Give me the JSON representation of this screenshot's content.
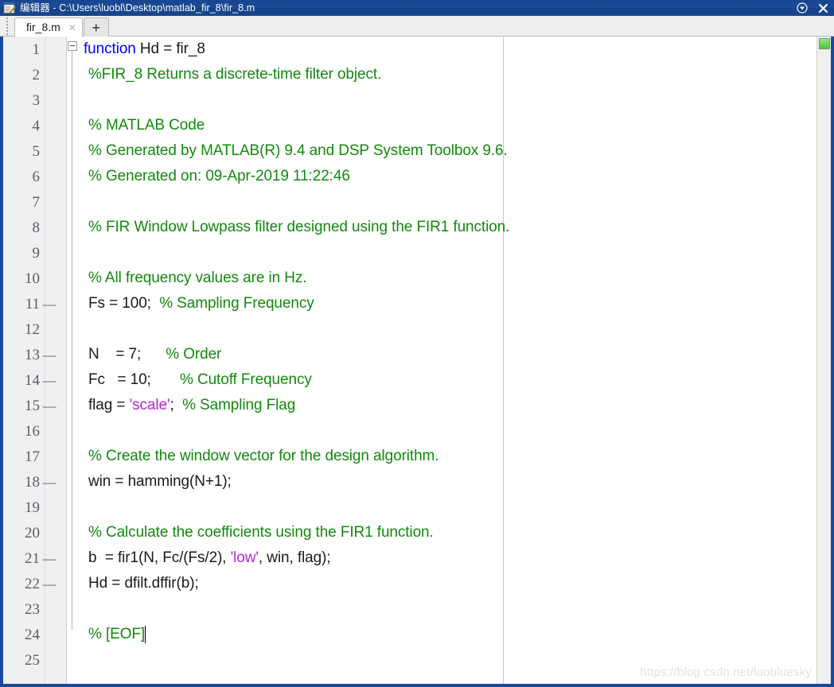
{
  "window": {
    "title_app": "编辑器",
    "title_separator": " - ",
    "title_path": "C:\\Users\\luobl\\Desktop\\matlab_fir_8\\fir_8.m",
    "app_icon": "editor-notepad-pencil-icon",
    "controls": [
      {
        "name": "dock-menu-button",
        "glyph": "▼"
      },
      {
        "name": "close-button",
        "glyph": "✕"
      }
    ],
    "colors": {
      "titlebar": "#1b4b98",
      "frame_border": "#1b4b98",
      "gutter_bg": "#f0f0f0",
      "editor_bg": "#ffffff",
      "keyword": "#0000ff",
      "comment": "#12890d",
      "string": "#b526d4",
      "text": "#1a1a1a",
      "analyzer_ok": "#49c63a"
    }
  },
  "tabbar": {
    "grip_name": "tabbar-drag-grip",
    "tabs": [
      {
        "label": "fir_8.m",
        "close_glyph": "✕",
        "active": true
      }
    ],
    "new_tab_glyph": "+"
  },
  "analyzer": {
    "status": "ok",
    "tooltip": "No warnings or errors"
  },
  "editor": {
    "fold_marker": "−",
    "caret_line": 24,
    "total_lines": 25,
    "lines": [
      {
        "n": 1,
        "breakpoint": false,
        "indent": 0,
        "tokens": [
          {
            "t": "kw",
            "s": "function"
          },
          {
            "t": "plain",
            "s": " Hd = fir_8"
          }
        ]
      },
      {
        "n": 2,
        "breakpoint": false,
        "indent": 1,
        "tokens": [
          {
            "t": "cmt",
            "s": "%FIR_8 Returns a discrete-time filter object."
          }
        ]
      },
      {
        "n": 3,
        "breakpoint": false,
        "indent": 1,
        "tokens": []
      },
      {
        "n": 4,
        "breakpoint": false,
        "indent": 1,
        "tokens": [
          {
            "t": "cmt",
            "s": "% MATLAB Code"
          }
        ]
      },
      {
        "n": 5,
        "breakpoint": false,
        "indent": 1,
        "tokens": [
          {
            "t": "cmt",
            "s": "% Generated by MATLAB(R) 9.4 and DSP System Toolbox 9.6."
          }
        ]
      },
      {
        "n": 6,
        "breakpoint": false,
        "indent": 1,
        "tokens": [
          {
            "t": "cmt",
            "s": "% Generated on: 09-Apr-2019 11:22:46"
          }
        ]
      },
      {
        "n": 7,
        "breakpoint": false,
        "indent": 1,
        "tokens": []
      },
      {
        "n": 8,
        "breakpoint": false,
        "indent": 1,
        "tokens": [
          {
            "t": "cmt",
            "s": "% FIR Window Lowpass filter designed using the FIR1 function."
          }
        ]
      },
      {
        "n": 9,
        "breakpoint": false,
        "indent": 1,
        "tokens": []
      },
      {
        "n": 10,
        "breakpoint": false,
        "indent": 1,
        "tokens": [
          {
            "t": "cmt",
            "s": "% All frequency values are in Hz."
          }
        ]
      },
      {
        "n": 11,
        "breakpoint": true,
        "indent": 1,
        "tokens": [
          {
            "t": "plain",
            "s": "Fs = 100;  "
          },
          {
            "t": "cmt",
            "s": "% Sampling Frequency"
          }
        ]
      },
      {
        "n": 12,
        "breakpoint": false,
        "indent": 1,
        "tokens": []
      },
      {
        "n": 13,
        "breakpoint": true,
        "indent": 1,
        "tokens": [
          {
            "t": "plain",
            "s": "N    = 7;      "
          },
          {
            "t": "cmt",
            "s": "% Order"
          }
        ]
      },
      {
        "n": 14,
        "breakpoint": true,
        "indent": 1,
        "tokens": [
          {
            "t": "plain",
            "s": "Fc   = 10;       "
          },
          {
            "t": "cmt",
            "s": "% Cutoff Frequency"
          }
        ]
      },
      {
        "n": 15,
        "breakpoint": true,
        "indent": 1,
        "tokens": [
          {
            "t": "plain",
            "s": "flag = "
          },
          {
            "t": "str",
            "s": "'scale'"
          },
          {
            "t": "plain",
            "s": ";  "
          },
          {
            "t": "cmt",
            "s": "% Sampling Flag"
          }
        ]
      },
      {
        "n": 16,
        "breakpoint": false,
        "indent": 1,
        "tokens": []
      },
      {
        "n": 17,
        "breakpoint": false,
        "indent": 1,
        "tokens": [
          {
            "t": "cmt",
            "s": "% Create the window vector for the design algorithm."
          }
        ]
      },
      {
        "n": 18,
        "breakpoint": true,
        "indent": 1,
        "tokens": [
          {
            "t": "plain",
            "s": "win = hamming(N+1);"
          }
        ]
      },
      {
        "n": 19,
        "breakpoint": false,
        "indent": 1,
        "tokens": []
      },
      {
        "n": 20,
        "breakpoint": false,
        "indent": 1,
        "tokens": [
          {
            "t": "cmt",
            "s": "% Calculate the coefficients using the FIR1 function."
          }
        ]
      },
      {
        "n": 21,
        "breakpoint": true,
        "indent": 1,
        "tokens": [
          {
            "t": "plain",
            "s": "b  = fir1(N, Fc/(Fs/2), "
          },
          {
            "t": "str",
            "s": "'low'"
          },
          {
            "t": "plain",
            "s": ", win, flag);"
          }
        ]
      },
      {
        "n": 22,
        "breakpoint": true,
        "indent": 1,
        "tokens": [
          {
            "t": "plain",
            "s": "Hd = dfilt.dffir(b);"
          }
        ]
      },
      {
        "n": 23,
        "breakpoint": false,
        "indent": 1,
        "tokens": []
      },
      {
        "n": 24,
        "breakpoint": false,
        "indent": 1,
        "tokens": [
          {
            "t": "cmt",
            "s": "% [EOF]"
          }
        ],
        "caret": true
      },
      {
        "n": 25,
        "breakpoint": false,
        "indent": 1,
        "tokens": []
      }
    ]
  },
  "watermark": {
    "text": "https://blog.csdn.net/luobluesky"
  }
}
